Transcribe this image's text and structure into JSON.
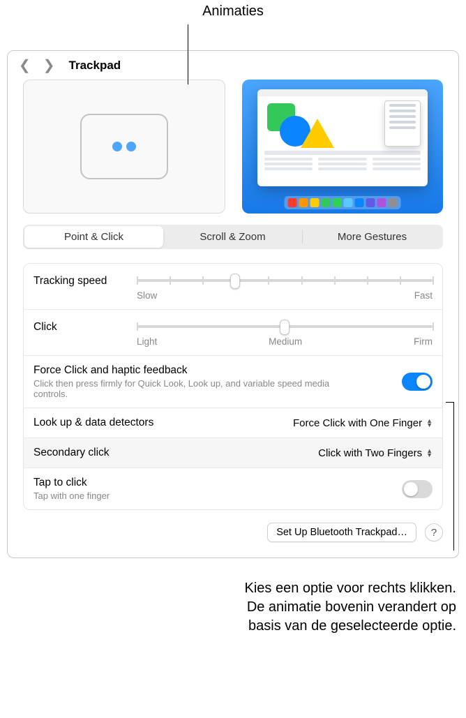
{
  "callouts": {
    "top": "Animaties",
    "bottom_line1": "Kies een optie voor rechts klikken.",
    "bottom_line2": "De animatie bovenin verandert op",
    "bottom_line3": "basis van de geselecteerde optie."
  },
  "header": {
    "title": "Trackpad"
  },
  "tabs": {
    "point_click": "Point & Click",
    "scroll_zoom": "Scroll & Zoom",
    "more_gestures": "More Gestures"
  },
  "sliders": {
    "tracking": {
      "label": "Tracking speed",
      "min_label": "Slow",
      "max_label": "Fast",
      "ticks": 10,
      "value_index": 3
    },
    "click": {
      "label": "Click",
      "min_label": "Light",
      "mid_label": "Medium",
      "max_label": "Firm",
      "ticks": 3,
      "value_index": 1
    }
  },
  "rows": {
    "force_click": {
      "label": "Force Click and haptic feedback",
      "desc": "Click then press firmly for Quick Look, Look up, and variable speed media controls.",
      "on": true
    },
    "lookup": {
      "label": "Look up & data detectors",
      "value": "Force Click with One Finger"
    },
    "secondary": {
      "label": "Secondary click",
      "value": "Click with Two Fingers"
    },
    "tap": {
      "label": "Tap to click",
      "desc": "Tap with one finger",
      "on": false
    }
  },
  "footer": {
    "bluetooth": "Set Up Bluetooth Trackpad…",
    "help": "?"
  },
  "dock_colors": [
    "#ff3b30",
    "#ff9500",
    "#ffcc00",
    "#34c759",
    "#30d158",
    "#5ac8fa",
    "#0a84ff",
    "#5e5ce6",
    "#af52de",
    "#8e8e93"
  ]
}
